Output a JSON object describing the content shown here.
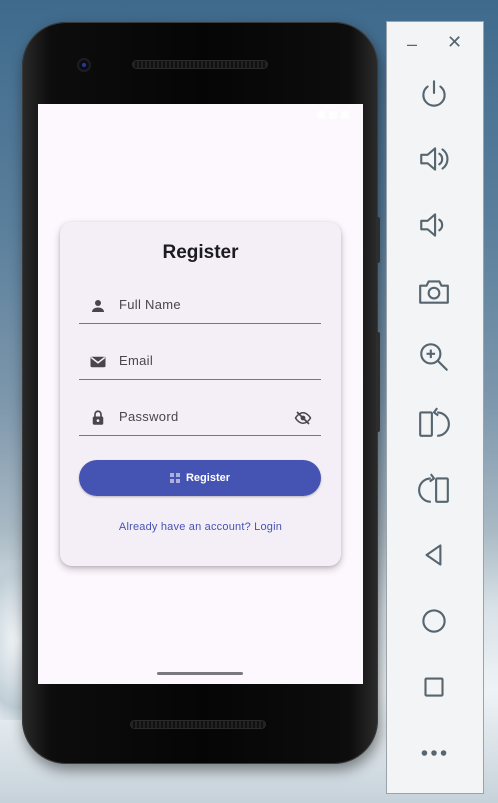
{
  "emulator": {
    "minimize_label": "–",
    "close_label": "✕",
    "controls": [
      {
        "name": "power-icon"
      },
      {
        "name": "volume-up-icon"
      },
      {
        "name": "volume-down-icon"
      },
      {
        "name": "camera-icon"
      },
      {
        "name": "zoom-in-icon"
      },
      {
        "name": "rotate-left-icon"
      },
      {
        "name": "rotate-right-icon"
      },
      {
        "name": "back-icon"
      },
      {
        "name": "home-icon"
      },
      {
        "name": "overview-icon"
      },
      {
        "name": "more-icon"
      }
    ]
  },
  "register": {
    "title": "Register",
    "full_name_placeholder": "Full Name",
    "email_placeholder": "Email",
    "password_placeholder": "Password",
    "submit_label": "Register",
    "login_link": "Already have an account? Login"
  },
  "colors": {
    "primary": "#4553b3",
    "screen_bg": "#fdf7fe",
    "card_bg": "#f4eff6"
  }
}
